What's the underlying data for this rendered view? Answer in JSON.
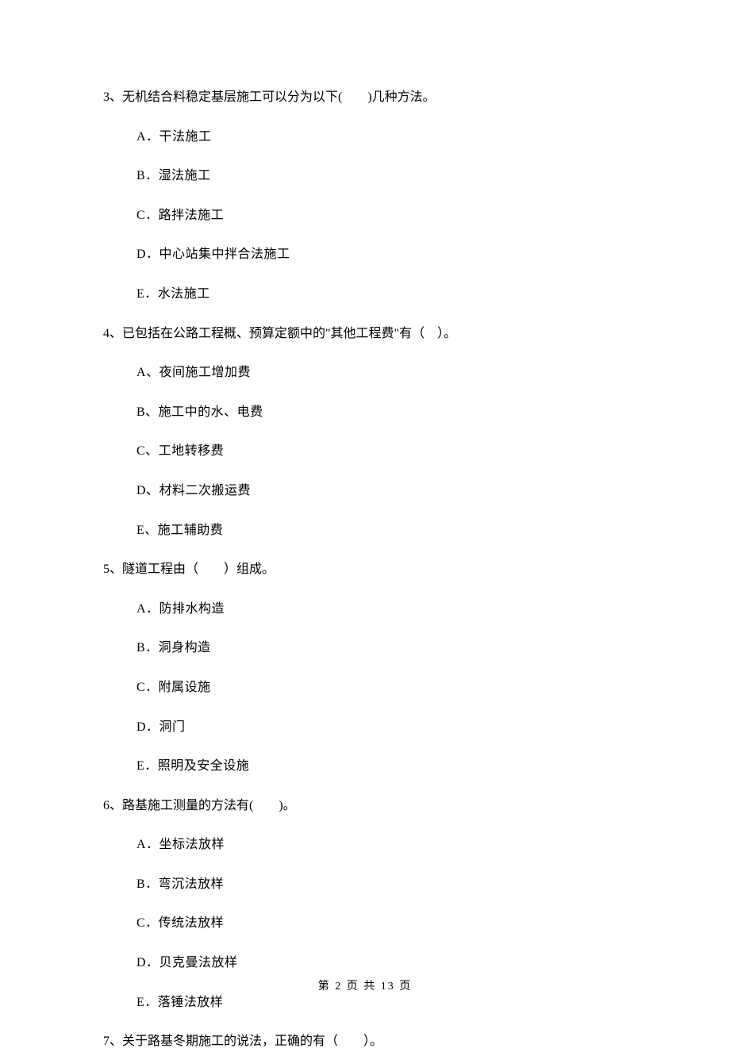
{
  "q3": {
    "text": "3、无机结合料稳定基层施工可以分为以下(　　)几种方法。",
    "a": "A．干法施工",
    "b": "B．湿法施工",
    "c": "C．路拌法施工",
    "d": "D．中心站集中拌合法施工",
    "e": "E．水法施工"
  },
  "q4": {
    "text": "4、已包括在公路工程概、预算定额中的\"其他工程费\"有（　）。",
    "a": "A、夜间施工增加费",
    "b": "B、施工中的水、电费",
    "c": "C、工地转移费",
    "d": "D、材料二次搬运费",
    "e": "E、施工辅助费"
  },
  "q5": {
    "text": "5、隧道工程由（　　）组成。",
    "a": "A．防排水构造",
    "b": "B．洞身构造",
    "c": "C．附属设施",
    "d": "D．洞门",
    "e": "E．照明及安全设施"
  },
  "q6": {
    "text": "6、路基施工测量的方法有(　　)。",
    "a": "A．坐标法放样",
    "b": "B．弯沉法放样",
    "c": "C．传统法放样",
    "d": "D．贝克曼法放样",
    "e": "E．落锤法放样"
  },
  "q7": {
    "text": "7、关于路基冬期施工的说法，正确的有（　　）。"
  },
  "footer": "第 2 页 共 13 页"
}
